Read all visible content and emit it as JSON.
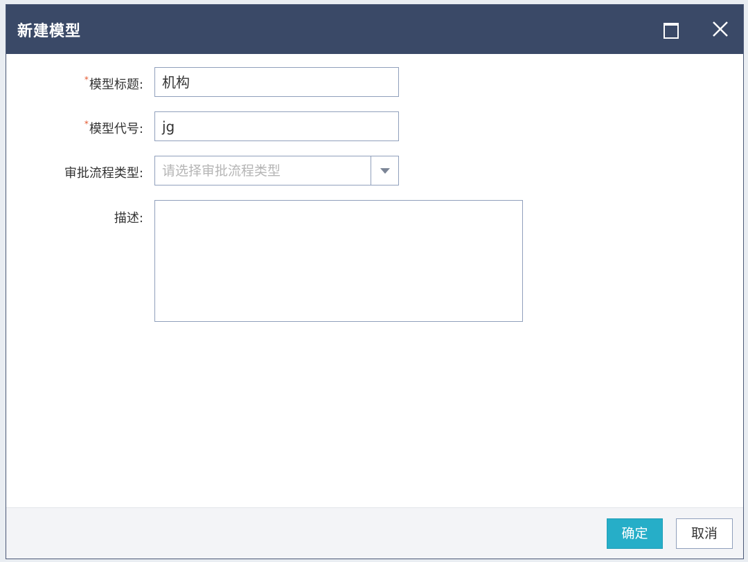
{
  "dialog": {
    "title": "新建模型",
    "title_color": "#3a4967"
  },
  "form": {
    "title_field": {
      "required_mark": "*",
      "label": "模型标题:",
      "value": "机构"
    },
    "code_field": {
      "required_mark": "*",
      "label": "模型代号:",
      "value": "jg"
    },
    "approval_type": {
      "label": "审批流程类型:",
      "placeholder": "请选择审批流程类型"
    },
    "description": {
      "label": "描述:",
      "value": ""
    }
  },
  "footer": {
    "confirm_label": "确定",
    "cancel_label": "取消",
    "accent_color": "#26aec8"
  },
  "icons": {
    "maximize": "maximize-icon",
    "close": "close-icon",
    "dropdown": "chevron-down-icon"
  }
}
